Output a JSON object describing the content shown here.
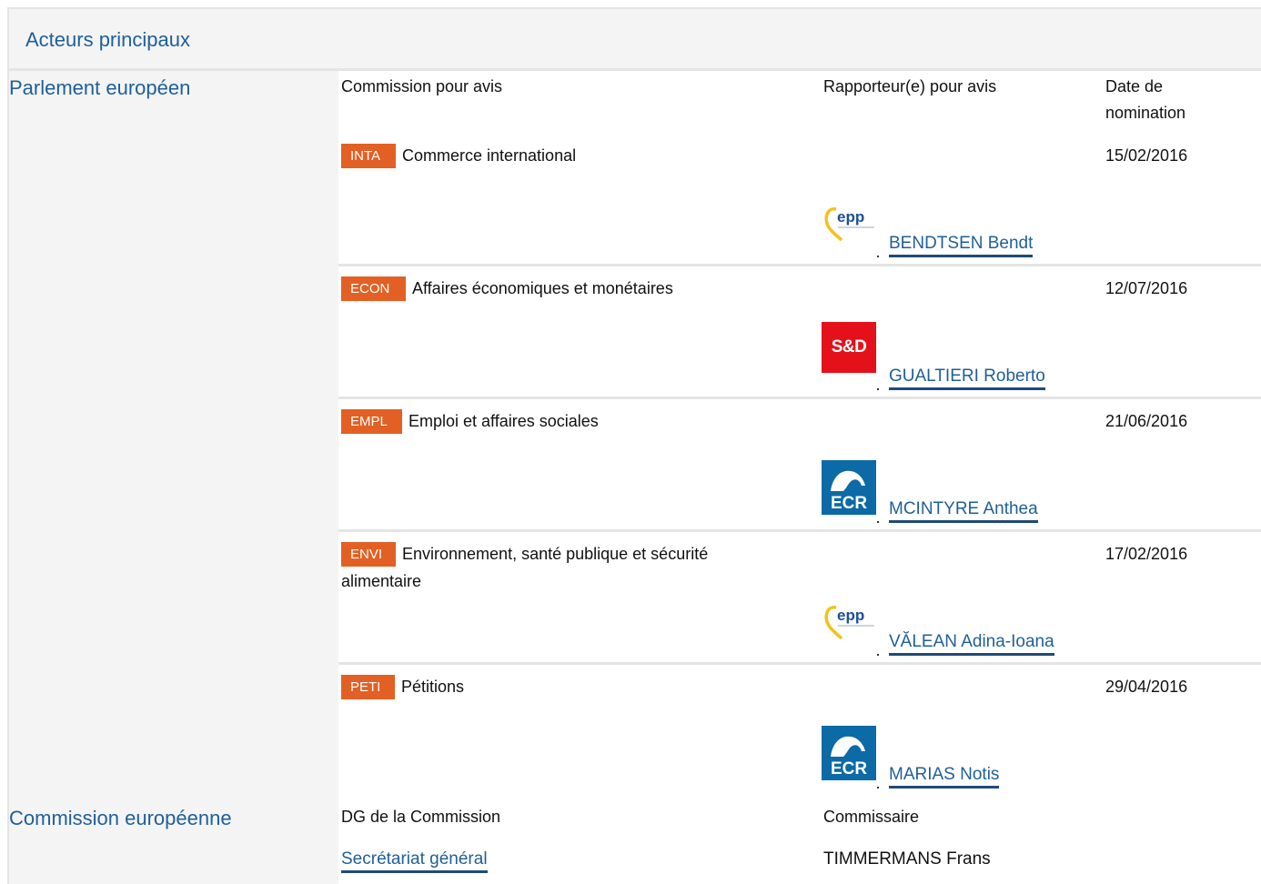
{
  "header": {
    "title": "Acteurs principaux"
  },
  "parliament": {
    "title": "Parlement européen",
    "col_committee": "Commission pour avis",
    "col_rapporteur": "Rapporteur(e) pour avis",
    "col_date_line1": "Date de",
    "col_date_line2": "nomination",
    "rows": [
      {
        "code": "INTA",
        "name": "Commerce international",
        "name2": "",
        "date": "15/02/2016",
        "group": "epp",
        "group_label": "epp",
        "rapporteur": "BENDTSEN Bendt"
      },
      {
        "code": "ECON",
        "name": "Affaires économiques et monétaires",
        "name2": "",
        "date": "12/07/2016",
        "group": "sd",
        "group_label": "S&D",
        "rapporteur": "GUALTIERI Roberto"
      },
      {
        "code": "EMPL",
        "name": "Emploi et affaires sociales",
        "name2": "",
        "date": "21/06/2016",
        "group": "ecr",
        "group_label": "ECR",
        "rapporteur": "MCINTYRE Anthea"
      },
      {
        "code": "ENVI",
        "name": "Environnement, santé publique et sécurité",
        "name2": "alimentaire",
        "date": "17/02/2016",
        "group": "epp",
        "group_label": "epp",
        "rapporteur": "VĂLEAN Adina-Ioana"
      },
      {
        "code": "PETI",
        "name": "Pétitions",
        "name2": "",
        "date": "29/04/2016",
        "group": "ecr",
        "group_label": "ECR",
        "rapporteur": "MARIAS Notis"
      }
    ]
  },
  "commission": {
    "title": "Commission européenne",
    "col_dg": "DG de la Commission",
    "col_commissioner": "Commissaire",
    "dg": "Secrétariat général",
    "commissioner": "TIMMERMANS Frans"
  },
  "colors": {
    "accent": "#1f5f9a",
    "badge": "#e26023",
    "sd": "#e4111b",
    "ecr": "#0c6aa6",
    "epp_blue": "#1d4f9c",
    "epp_yellow": "#f3c21b"
  }
}
